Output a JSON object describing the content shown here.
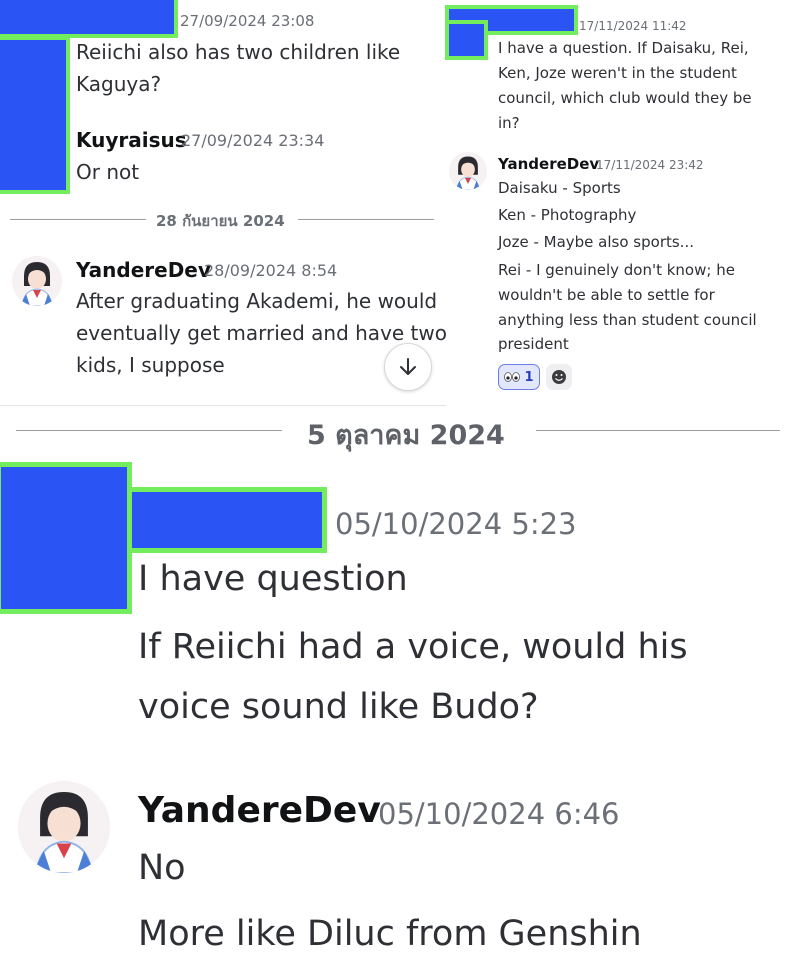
{
  "panel1": {
    "msg1": {
      "timestamp": "27/09/2024 23:08",
      "lines": [
        "Reiichi also has two children like",
        "Kaguya?"
      ]
    },
    "msg2": {
      "username": "Kuyraisus",
      "timestamp": "27/09/2024 23:34",
      "text": "Or not"
    },
    "date_separator": "28 กันยายน 2024",
    "msg3": {
      "username": "YandereDev",
      "timestamp": "28/09/2024 8:54",
      "lines": [
        "After graduating Akademi, he would",
        "eventually get married and have two",
        "kids, I suppose"
      ]
    }
  },
  "panel2": {
    "msg1": {
      "timestamp": "17/11/2024 11:42",
      "lines": [
        "I have a question. If Daisaku, Rei,",
        "Ken, Joze weren't in the student",
        "council, which club would they be",
        "in?"
      ]
    },
    "msg2": {
      "username": "YandereDev",
      "timestamp": "17/11/2024 23:42",
      "lines": [
        "Daisaku - Sports",
        "Ken - Photography",
        "Joze - Maybe also sports..."
      ],
      "rei_lines": [
        "Rei - I genuinely don't know; he",
        "wouldn't be able to settle for",
        "anything less than student council",
        "president"
      ],
      "reaction_count": "1"
    }
  },
  "panel3": {
    "date_separator": "5 ตุลาคม 2024",
    "msg1": {
      "timestamp": "05/10/2024 5:23",
      "lines": [
        "I have question",
        "If Reiichi had a voice, would his",
        "voice sound like Budo?"
      ]
    },
    "msg2": {
      "username": "YandereDev",
      "timestamp": "05/10/2024 6:46",
      "lines": [
        "No",
        "More like Diluc from Genshin"
      ]
    }
  },
  "colors": {
    "redaction_fill": "#2b54f5",
    "redaction_border": "#73ec5d",
    "reaction_bg": "#e3e7fb"
  }
}
